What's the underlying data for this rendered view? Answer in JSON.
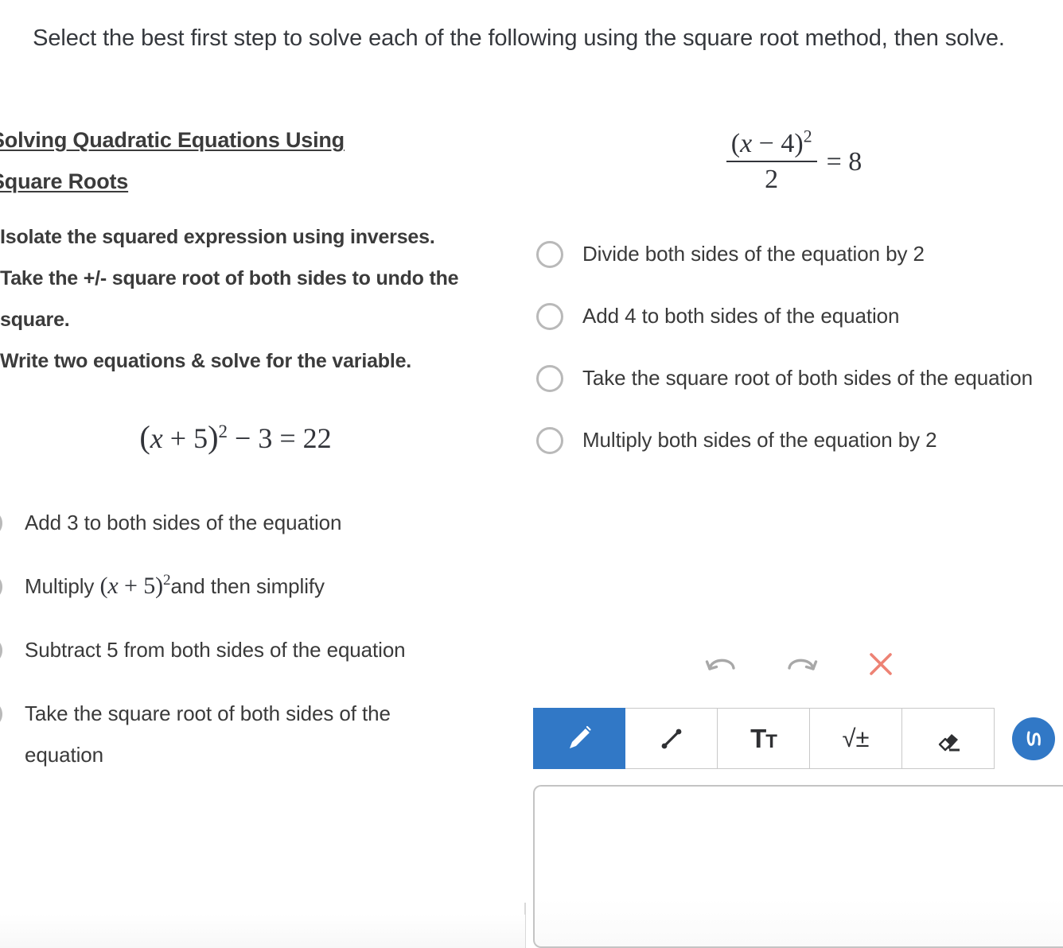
{
  "prompt": {
    "text": "Select the best first step to solve each of the following using the square root method, then solve."
  },
  "left_panel": {
    "lesson_title": "Solving Quadratic Equations Using Square Roots",
    "steps": [
      "Isolate the squared expression using inverses.",
      "Take the +/- square root of both sides to undo the square.",
      "Write two equations & solve for the variable."
    ],
    "equation": {
      "lhs_open": "(",
      "lhs_var": "x",
      "lhs_op": " + ",
      "lhs_num": "5",
      "lhs_close": ")",
      "exponent": "2",
      "tail": " − 3 = 22"
    },
    "options": [
      {
        "label": "Add 3 to both sides of the equation",
        "selected": false
      },
      {
        "label_pre": "Multiply ",
        "has_math": true,
        "label_post": "and then simplify",
        "selected": false
      },
      {
        "label": "Subtract 5 from both sides of the equation",
        "selected": false
      },
      {
        "label": "Take the square root of both sides of the equation",
        "selected": false
      }
    ],
    "option_math": {
      "open": "(",
      "var": "x",
      "op": " + ",
      "num": "5",
      "close": ")",
      "exponent": "2"
    }
  },
  "right_panel": {
    "equation": {
      "num_open": "(",
      "num_var": "x",
      "num_op": " − ",
      "num_val": "4",
      "num_close": ")",
      "num_exp": "2",
      "denominator": "2",
      "rhs": "= 8"
    },
    "options": [
      {
        "label": "Divide both sides of the equation by 2",
        "selected": false
      },
      {
        "label": "Add 4 to both sides of the equation",
        "selected": false
      },
      {
        "label": "Take the square root of both sides of the equation",
        "selected": false
      },
      {
        "label": "Multiply both sides of the equation by 2",
        "selected": false
      }
    ]
  },
  "draw_widget": {
    "actions": [
      {
        "name": "undo",
        "label": "↶"
      },
      {
        "name": "redo",
        "label": "↷"
      },
      {
        "name": "clear",
        "label": "✕"
      }
    ],
    "tools": [
      {
        "name": "pencil",
        "label": "pencil",
        "active": true
      },
      {
        "name": "line",
        "label": "line",
        "active": false
      },
      {
        "name": "text",
        "label": "T",
        "label_small": "T",
        "active": false
      },
      {
        "name": "math",
        "label": "√±",
        "active": false
      },
      {
        "name": "eraser",
        "label": "eraser",
        "active": false
      }
    ],
    "stroke_preview_label": "stroke",
    "caret_label": "open stroke options",
    "canvas_placeholder": ""
  },
  "colors": {
    "accent_blue": "#3178c6",
    "clear_red": "#ed8274",
    "radio_border": "#b9b9b9",
    "text": "#3a3a3a",
    "border": "#c9c9c9"
  }
}
